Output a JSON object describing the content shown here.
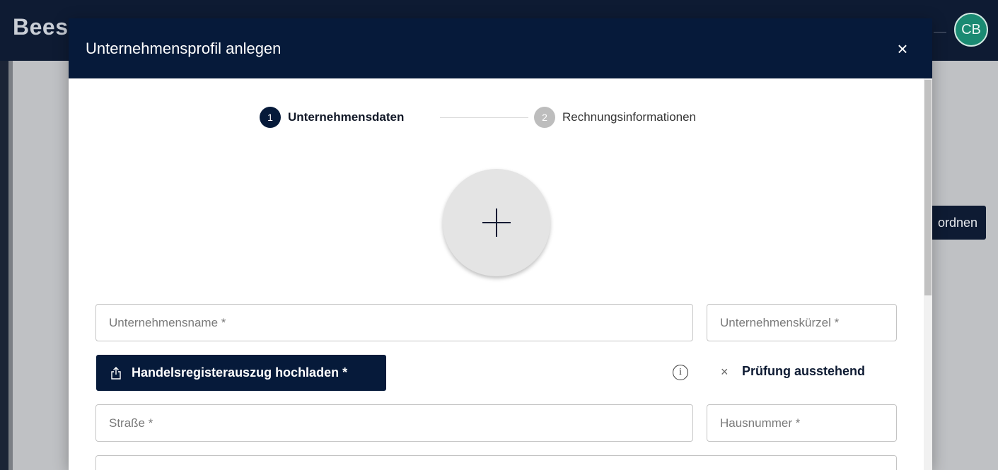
{
  "app": {
    "logo_text": "Bees",
    "avatar_initials": "CB",
    "bg_button_label": "ordnen"
  },
  "modal": {
    "title": "Unternehmensprofil anlegen",
    "close_symbol": "×"
  },
  "stepper": {
    "steps": [
      {
        "number": "1",
        "label": "Unternehmensdaten",
        "active": true
      },
      {
        "number": "2",
        "label": "Rechnungsinformationen",
        "active": false
      }
    ]
  },
  "form": {
    "company_name": {
      "placeholder": "Unternehmensname *",
      "value": ""
    },
    "company_short": {
      "placeholder": "Unternehmenskürzel *",
      "value": ""
    },
    "upload_button_label": "Handelsregisterauszug hochladen *",
    "status_symbol": "×",
    "status_text": "Prüfung ausstehend",
    "street": {
      "placeholder": "Straße *",
      "value": ""
    },
    "house_number": {
      "placeholder": "Hausnummer *",
      "value": ""
    }
  },
  "colors": {
    "primary": "#061a3a",
    "avatar": "#1a8a72"
  }
}
